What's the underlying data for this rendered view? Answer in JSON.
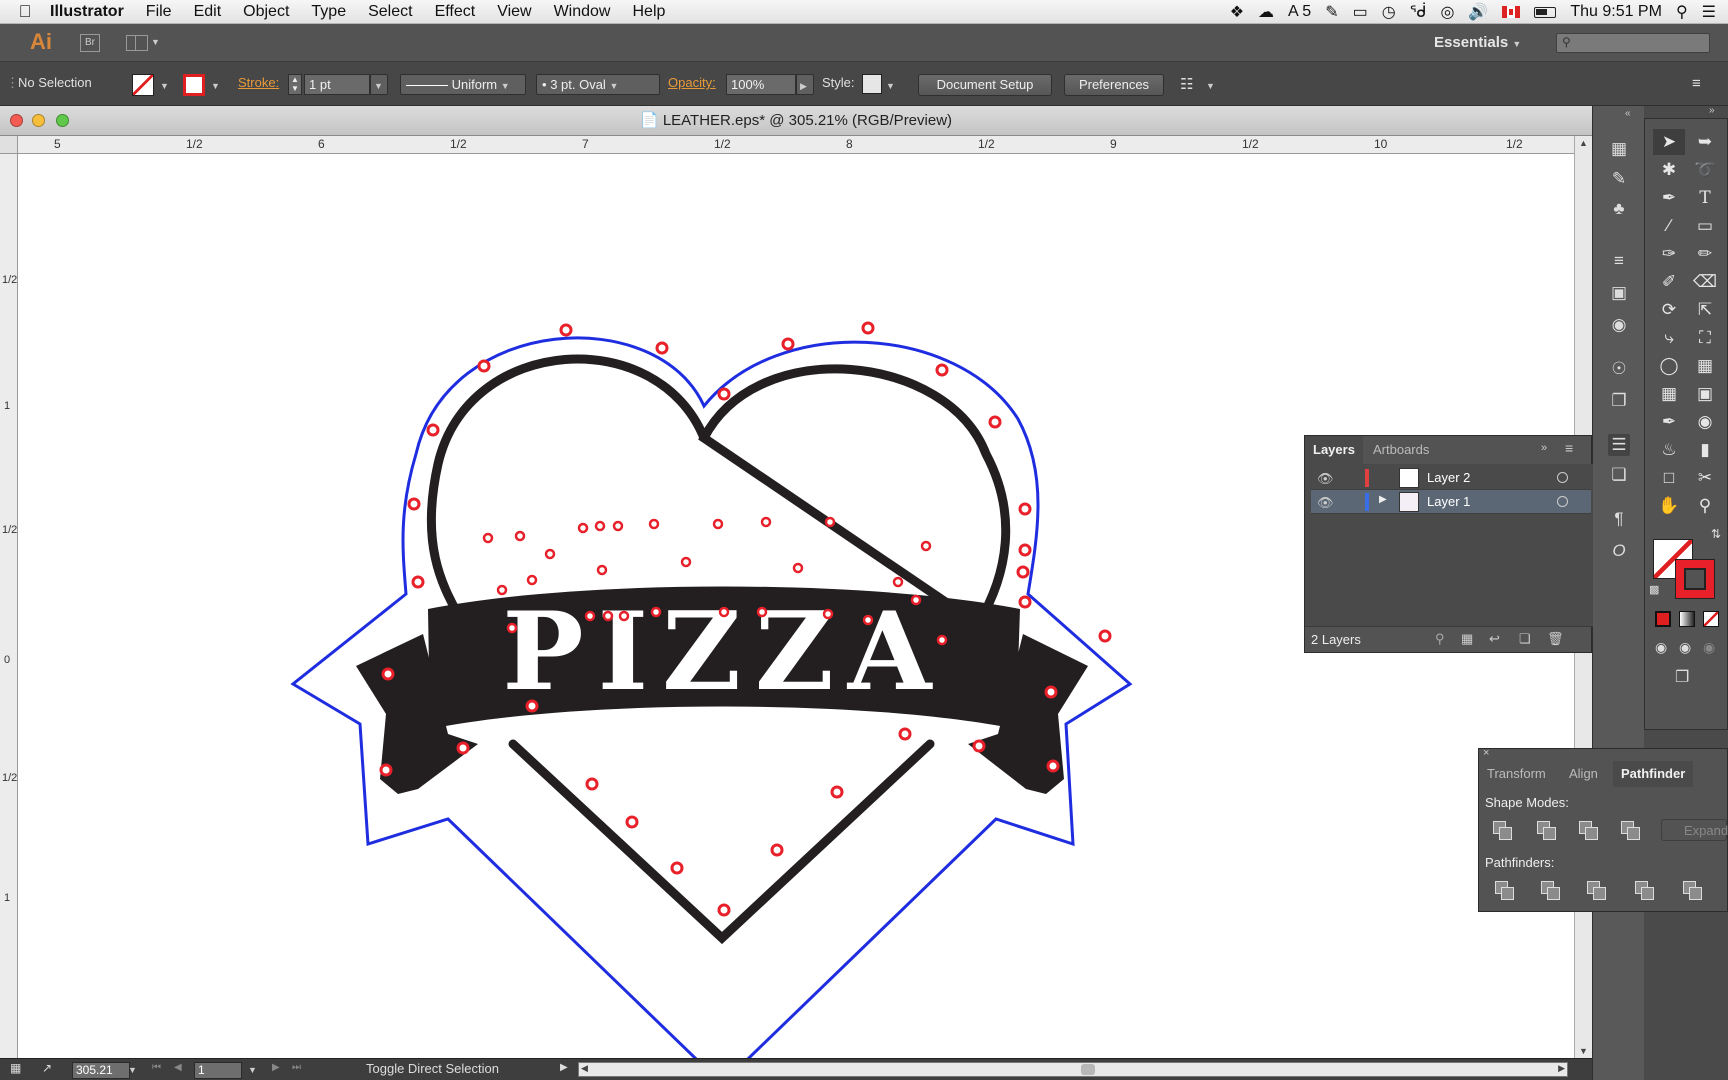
{
  "menubar": {
    "app_name": "Illustrator",
    "items": [
      "File",
      "Edit",
      "Object",
      "Type",
      "Select",
      "Effect",
      "View",
      "Window",
      "Help"
    ],
    "status": {
      "adobe_count": "5",
      "clock": "Thu 9:51 PM"
    }
  },
  "appbar": {
    "logo": "Ai",
    "bridge": "Br",
    "workspace": "Essentials",
    "search_placeholder": ""
  },
  "control": {
    "selection": "No Selection",
    "stroke_label": "Stroke:",
    "stroke_weight": "1 pt",
    "profile": "Uniform",
    "brush": "3 pt. Oval",
    "opacity_label": "Opacity:",
    "opacity_value": "100%",
    "style_label": "Style:",
    "document_setup": "Document Setup",
    "preferences": "Preferences"
  },
  "document": {
    "title": "LEATHER.eps* @ 305.21% (RGB/Preview)",
    "ruler_h": [
      "5",
      "1/2",
      "6",
      "1/2",
      "7",
      "1/2",
      "8",
      "1/2",
      "9",
      "1/2",
      "10",
      "1/2"
    ],
    "ruler_v": [
      "1/2",
      "1",
      "1/2",
      "0",
      "1/2",
      "1"
    ],
    "artwork_text": "PIZZA",
    "zoom": "305.21",
    "artboard": "1",
    "status_text": "Toggle Direct Selection"
  },
  "colors": {
    "outline_blue": "#1f2de0",
    "rivet_red": "#e8202a",
    "ink": "#231f20"
  },
  "layers_panel": {
    "tabs": [
      "Layers",
      "Artboards"
    ],
    "layers": [
      {
        "name": "Layer 2",
        "color": "#e04040",
        "selected": false
      },
      {
        "name": "Layer 1",
        "color": "#3a6ee8",
        "selected": true
      }
    ],
    "count": "2 Layers"
  },
  "pathfinder_panel": {
    "tabs": [
      "Transform",
      "Align",
      "Pathfinder"
    ],
    "shape_modes_label": "Shape Modes:",
    "expand": "Expand",
    "pathfinders_label": "Pathfinders:"
  }
}
